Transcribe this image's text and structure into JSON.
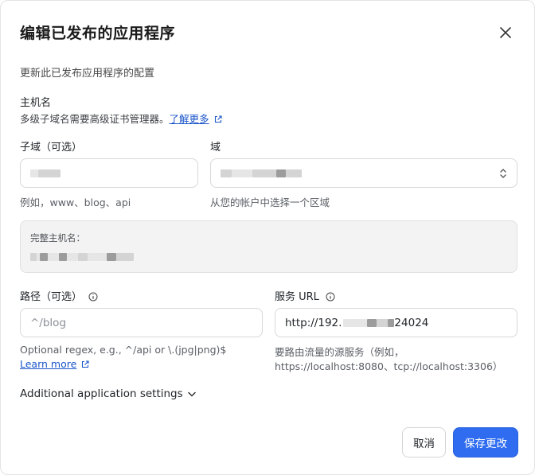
{
  "dialog": {
    "title": "编辑已发布的应用程序",
    "subtitle": "更新此已发布应用程序的配置"
  },
  "hostname": {
    "label": "主机名",
    "description": "多级子域名需要高级证书管理器。",
    "learn_more": "了解更多"
  },
  "subdomain": {
    "label": "子域（可选）",
    "hint": "例如，www、blog、api"
  },
  "domain": {
    "label": "域",
    "hint": "从您的帐户中选择一个区域"
  },
  "full_hostname": {
    "label": "完整主机名："
  },
  "path": {
    "label": "路径（可选）",
    "placeholder": "^/blog",
    "hint": "Optional regex, e.g., ^/api or \\.(jpg|png)$",
    "learn_more": "Learn more"
  },
  "service_url": {
    "label": "服务 URL",
    "value_prefix": "http://192.",
    "value_suffix": "24024",
    "hint_line1": "要路由流量的源服务（例如，",
    "hint_line2": "https://localhost:8080、tcp://localhost:3306）"
  },
  "advanced": {
    "label": "Additional application settings"
  },
  "buttons": {
    "cancel": "取消",
    "save": "保存更改"
  },
  "colors": {
    "primary": "#2f6cf0",
    "link": "#1a55c9"
  }
}
